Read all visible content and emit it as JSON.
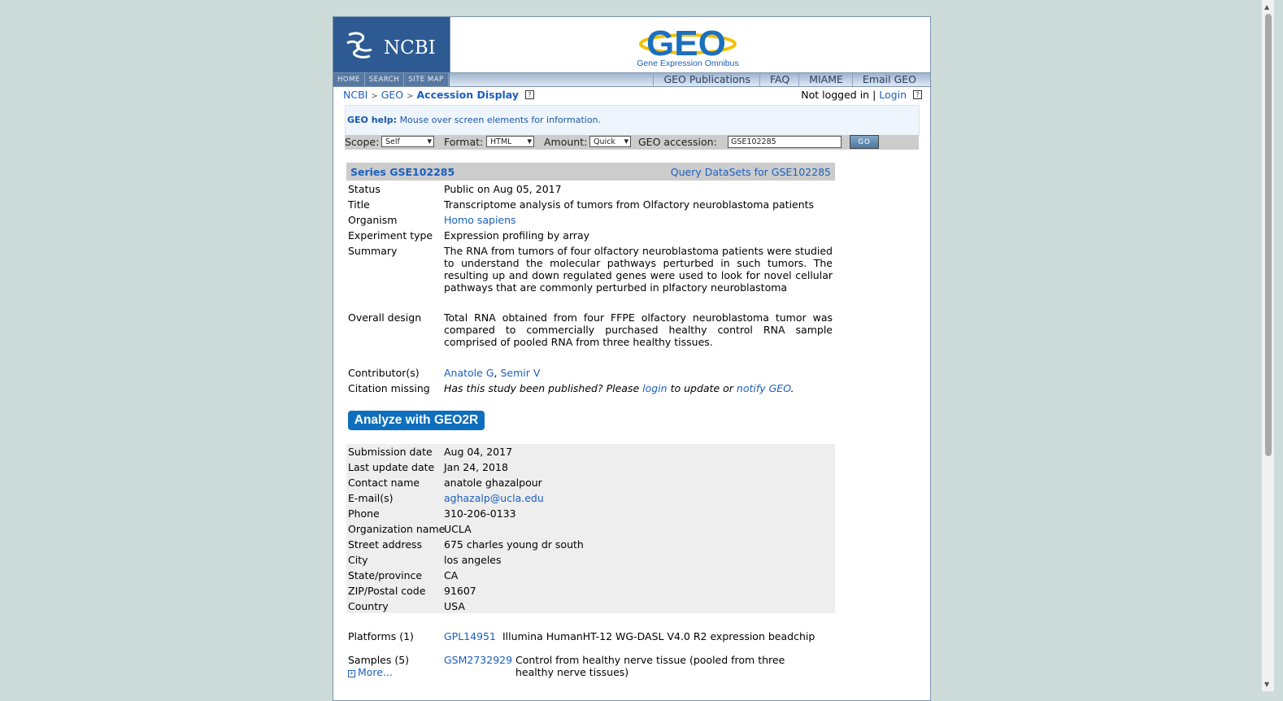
{
  "header": {
    "ncbi_logo": "NCBI",
    "geo_logo": "GEO",
    "geo_subtitle": "Gene Expression Omnibus",
    "nav_left": [
      "HOME",
      "SEARCH",
      "SITE MAP"
    ],
    "nav_right": [
      "GEO Publications",
      "FAQ",
      "MIAME",
      "Email GEO"
    ]
  },
  "breadcrumb": {
    "ncbi": "NCBI",
    "geo": "GEO",
    "current": "Accession Display",
    "sep": ">"
  },
  "login": {
    "status": "Not logged in",
    "sep": "|",
    "login": "Login"
  },
  "help": {
    "label": "GEO help:",
    "text": "Mouse over screen elements for information."
  },
  "toolbar": {
    "scope_label": "Scope:",
    "scope_value": "Self",
    "format_label": "Format:",
    "format_value": "HTML",
    "amount_label": "Amount:",
    "amount_value": "Quick",
    "accession_label": "GEO accession:",
    "accession_value": "GSE102285",
    "go": "GO"
  },
  "series": {
    "title": "Series GSE102285",
    "query_link": "Query DataSets for GSE102285",
    "fields": {
      "status_k": "Status",
      "status_v": "Public on Aug 05, 2017",
      "title_k": "Title",
      "title_v": "Transcriptome analysis of tumors from Olfactory neuroblastoma patients",
      "organism_k": "Organism",
      "organism_v": "Homo sapiens",
      "exptype_k": "Experiment type",
      "exptype_v": "Expression profiling by array",
      "summary_k": "Summary",
      "summary_v": "The RNA from tumors of four olfactory neuroblastoma patients were studied to understand the molecular pathways perturbed in such tumors. The resulting up and down regulated genes were used to look for novel cellular pathways that are commonly perturbed in plfactory neuroblastoma",
      "design_k": "Overall design",
      "design_v": "Total RNA obtained from four FFPE olfactory neuroblastoma tumor was compared to commercially purchased healthy control RNA sample comprised of pooled RNA from three healthy tissues.",
      "contrib_k": "Contributor(s)",
      "contrib_1": "Anatole G",
      "contrib_sep": ",",
      "contrib_2": "Semir V",
      "citation_k": "Citation missing",
      "citation_a": "Has this study been published? Please",
      "citation_login": "login",
      "citation_b": "to update or",
      "citation_notify": "notify GEO",
      "citation_end": "."
    },
    "geo2r": "Analyze with GEO2R",
    "contact": [
      {
        "k": "Submission date",
        "v": "Aug 04, 2017"
      },
      {
        "k": "Last update date",
        "v": "Jan 24, 2018"
      },
      {
        "k": "Contact name",
        "v": "anatole ghazalpour"
      },
      {
        "k": "E-mail(s)",
        "v": "aghazalp@ucla.edu"
      },
      {
        "k": "Phone",
        "v": "310-206-0133"
      },
      {
        "k": "Organization name",
        "v": "UCLA"
      },
      {
        "k": "Street address",
        "v": "675 charles young dr south"
      },
      {
        "k": "City",
        "v": "los angeles"
      },
      {
        "k": "State/province",
        "v": "CA"
      },
      {
        "k": "ZIP/Postal code",
        "v": "91607"
      },
      {
        "k": "Country",
        "v": "USA"
      }
    ],
    "platforms_k": "Platforms (1)",
    "platform_id": "GPL14951",
    "platform_desc": "Illumina HumanHT-12 WG-DASL V4.0 R2 expression beadchip",
    "samples_k": "Samples (5)",
    "samples_more": "More...",
    "sample_id": "GSM2732929",
    "sample_desc": "Control from healthy nerve tissue (pooled from three healthy nerve tissues)"
  },
  "colors": {
    "link": "#1b5fbf",
    "geo2r_button": "#0d6fbd",
    "ncbi_blue": "#2d5a93"
  }
}
